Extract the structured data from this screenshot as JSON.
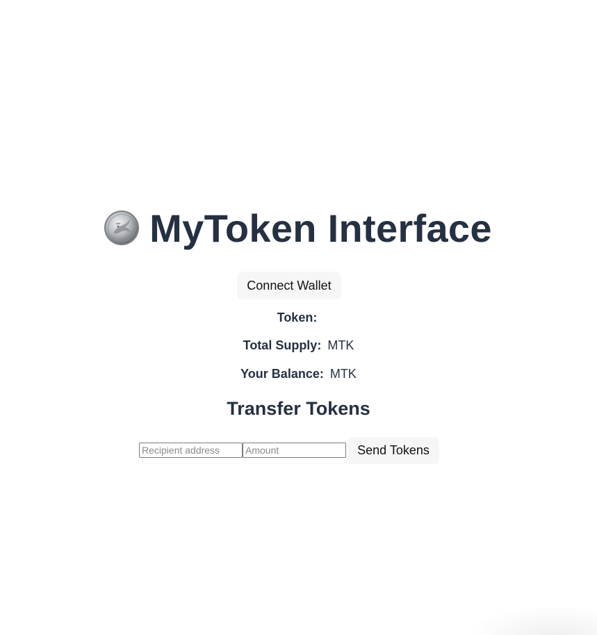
{
  "header": {
    "icon": "coin-icon",
    "title": "MyToken Interface"
  },
  "wallet": {
    "connect_label": "Connect Wallet"
  },
  "token_info": {
    "token_label": "Token:",
    "token_value": "",
    "supply_label": "Total Supply:",
    "supply_value": "MTK",
    "balance_label": "Your Balance:",
    "balance_value": "MTK"
  },
  "transfer": {
    "heading": "Transfer Tokens",
    "recipient_placeholder": "Recipient address",
    "amount_placeholder": "Amount",
    "send_label": "Send Tokens"
  },
  "colors": {
    "text": "#253142",
    "button_bg": "#f6f6f6"
  }
}
